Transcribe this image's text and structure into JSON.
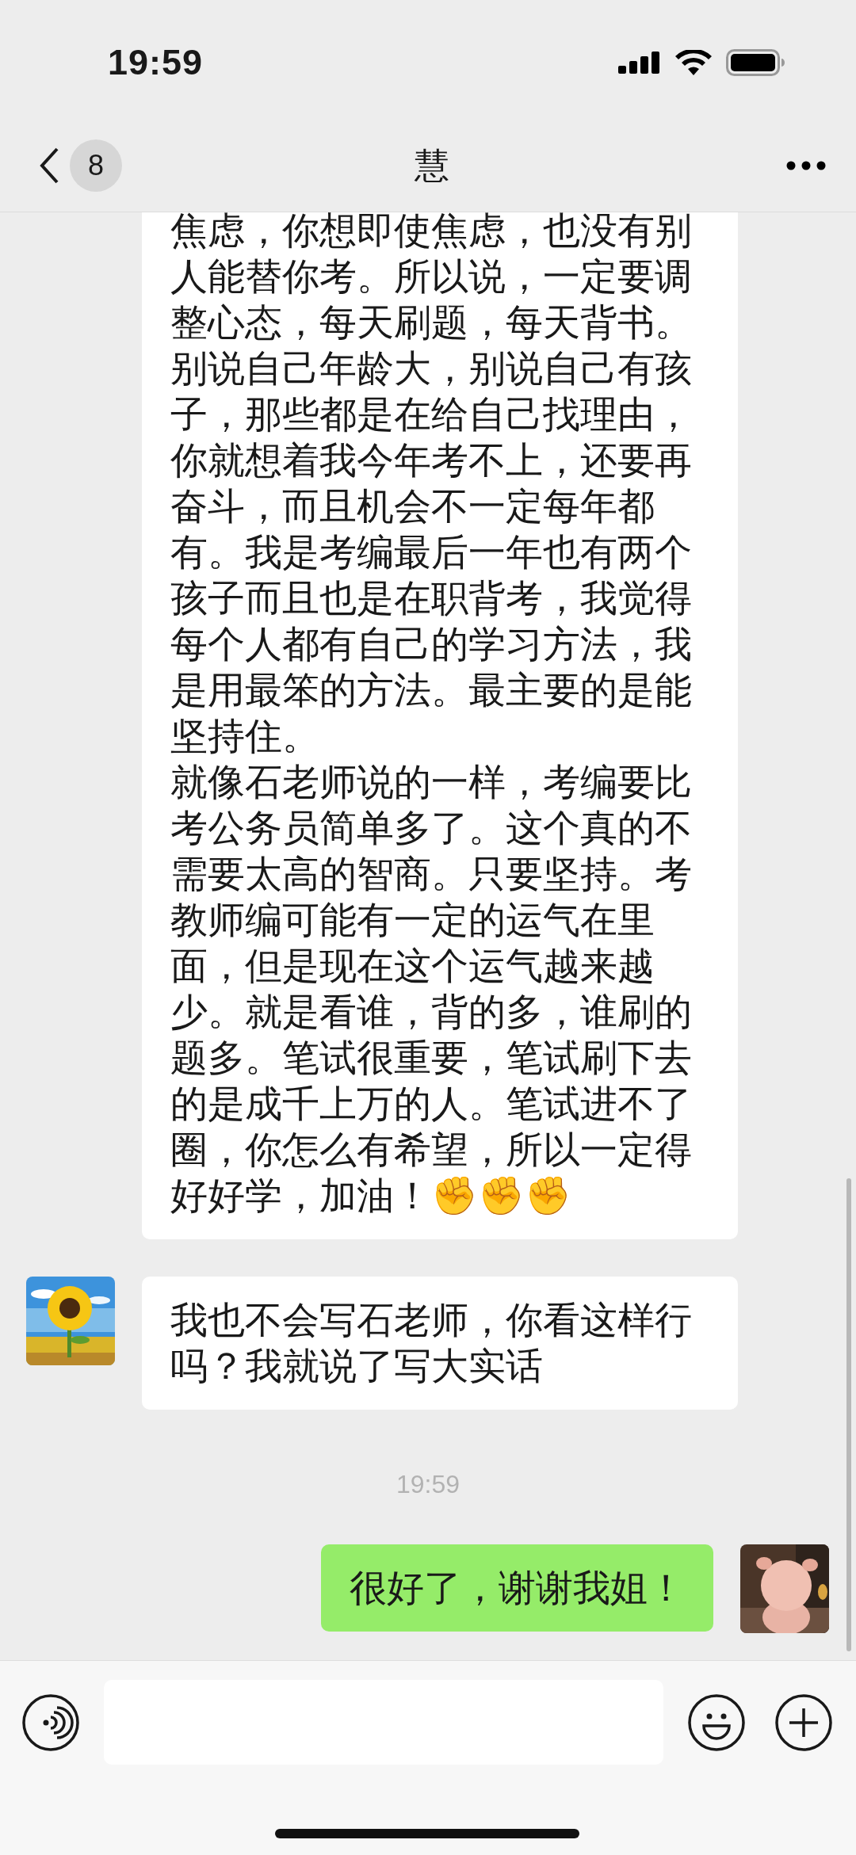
{
  "status_bar": {
    "time": "19:59"
  },
  "header": {
    "unread_count": "8",
    "title": "慧"
  },
  "messages": [
    {
      "kind": "received",
      "paragraphs": [
        "焦虑，你想即使焦虑，也没有别人能替你考。所以说，一定要调整心态，每天刷题，每天背书。别说自己年龄大，别说自己有孩子，那些都是在给自己找理由，你就想着我今年考不上，还要再奋斗，而且机会不一定每年都有。我是考编最后一年也有两个孩子而且也是在职背考，我觉得每个人都有自己的学习方法，我是用最笨的方法。最主要的是能坚持住。",
        "就像石老师说的一样，考编要比考公务员简单多了。这个真的不需要太高的智商。只要坚持。考教师编可能有一定的运气在里面，但是现在这个运气越来越少。就是看谁，背的多，谁刷的题多。笔试很重要，笔试刷下去的是成千上万的人。笔试进不了圈，你怎么有希望，所以一定得好好学，加油！✊✊✊"
      ]
    },
    {
      "kind": "received",
      "avatar": {
        "kind": "picture"
      },
      "paragraphs": [
        "我也不会写石老师，你看这样行吗？我就说了写大实话"
      ]
    },
    {
      "kind": "time",
      "text": "19:59"
    },
    {
      "kind": "sent",
      "avatar": {
        "kind": "picture"
      },
      "paragraphs": [
        "很好了，谢谢我姐！"
      ]
    }
  ]
}
